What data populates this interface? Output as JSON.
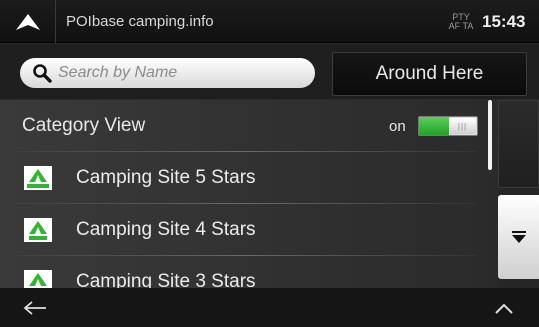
{
  "header": {
    "title": "POIbase camping.info",
    "status_line1": "PTY",
    "status_line2": "AF TA",
    "clock": "15:43",
    "nav_icon": "navigation-arrow-icon"
  },
  "search": {
    "placeholder": "Search by Name",
    "value": "",
    "icon": "search-icon",
    "around_label": "Around Here"
  },
  "category_view": {
    "label": "Category View",
    "toggle_state": "on",
    "toggle_on": true
  },
  "items": [
    {
      "label": "Camping Site 5 Stars",
      "icon": "camping-5-stars-icon"
    },
    {
      "label": "Camping Site 4 Stars",
      "icon": "camping-4-stars-icon"
    },
    {
      "label": "Camping Site 3 Stars",
      "icon": "camping-3-stars-icon"
    }
  ],
  "colors": {
    "accent_green": "#2fb52f",
    "background": "#2a2a2a",
    "topbar": "#111111"
  },
  "footer": {
    "back_icon": "back-arrow-icon",
    "up_icon": "chevron-up-icon"
  }
}
